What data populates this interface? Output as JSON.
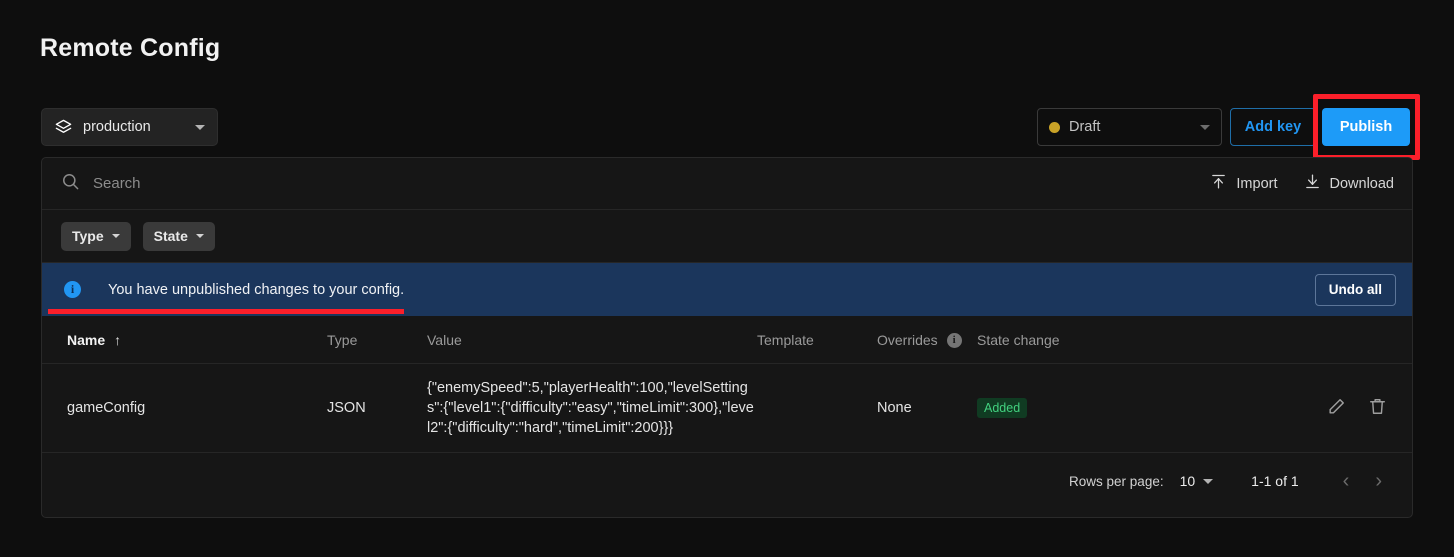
{
  "page": {
    "title": "Remote Config"
  },
  "toolbar": {
    "environment": {
      "value": "production",
      "icon": "layers-icon"
    },
    "status": {
      "value": "Draft",
      "dot_color": "#c9a227"
    },
    "add_key_label": "Add key",
    "publish_label": "Publish"
  },
  "search": {
    "placeholder": "Search",
    "value": "",
    "icon": "search-icon"
  },
  "actions": {
    "import_label": "Import",
    "download_label": "Download"
  },
  "filters": [
    {
      "label": "Type"
    },
    {
      "label": "State"
    }
  ],
  "banner": {
    "icon": "info-icon",
    "message": "You have unpublished changes to your config.",
    "undo_label": "Undo all"
  },
  "table": {
    "columns": [
      "Name",
      "Type",
      "Value",
      "Template",
      "Overrides",
      "State change"
    ],
    "sort": {
      "column": "Name",
      "direction": "ascending",
      "glyph": "↑"
    },
    "overrides_info_icon": "info-icon",
    "rows": [
      {
        "name": "gameConfig",
        "type": "JSON",
        "value": "{\"enemySpeed\":5,\"playerHealth\":100,\"levelSettings\":{\"level1\":{\"difficulty\":\"easy\",\"timeLimit\":300},\"level2\":{\"difficulty\":\"hard\",\"timeLimit\":200}}}",
        "template": "",
        "overrides": "None",
        "state_change": "Added",
        "state_change_color": "#42d17f",
        "edit_icon": "pencil-icon",
        "delete_icon": "trash-icon"
      }
    ]
  },
  "pagination": {
    "rows_per_page_label": "Rows per page:",
    "rows_per_page_value": "10",
    "range_label": "1-1 of 1",
    "prev_glyph": "‹",
    "next_glyph": "›"
  },
  "annotations": {
    "highlight_box_target": "publish-button",
    "underline_target": "banner-message",
    "color": "#fb1f2a"
  }
}
